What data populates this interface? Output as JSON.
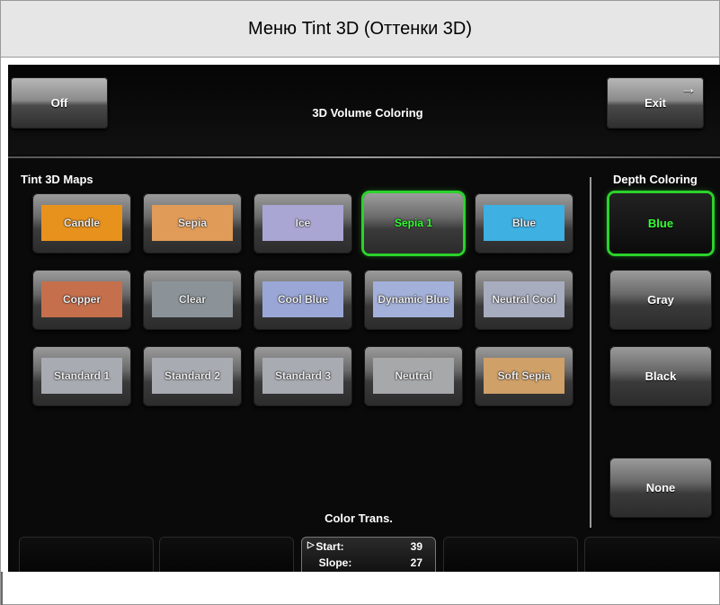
{
  "caption": "Меню Tint 3D (Оттенки 3D)",
  "header": {
    "off_label": "Off",
    "title": "3D Volume Coloring",
    "exit_label": "Exit"
  },
  "tint_maps": {
    "label": "Tint 3D Maps",
    "items": [
      {
        "label": "Candle",
        "color": "#e8921e"
      },
      {
        "label": "Sepia",
        "color": "#e09b58"
      },
      {
        "label": "Ice",
        "color": "#a9a6d3"
      },
      {
        "label": "Sepia 1",
        "color": "#e0a24a",
        "selected": true
      },
      {
        "label": "Blue",
        "color": "#3eb0e2"
      },
      {
        "label": "Copper",
        "color": "#c56f4c"
      },
      {
        "label": "Clear",
        "color": "#8b9398"
      },
      {
        "label": "Cool Blue",
        "color": "#9aa7d6"
      },
      {
        "label": "Dynamic Blue",
        "color": "#a3b0d9"
      },
      {
        "label": "Neutral Cool",
        "color": "#a7acbe"
      },
      {
        "label": "Standard 1",
        "color": "#a8abb1"
      },
      {
        "label": "Standard 2",
        "color": "#a8abb1"
      },
      {
        "label": "Standard 3",
        "color": "#a8abb1"
      },
      {
        "label": "Neutral",
        "color": "#a7a8aa"
      },
      {
        "label": "Soft Sepia",
        "color": "#cfa068"
      }
    ]
  },
  "depth_coloring": {
    "label": "Depth Coloring",
    "items": [
      {
        "label": "Blue",
        "selected": true
      },
      {
        "label": "Gray"
      },
      {
        "label": "Black"
      },
      {
        "label": "None"
      }
    ]
  },
  "color_trans": {
    "label": "Color Trans.",
    "start_label": "Start:",
    "start_value": "39",
    "slope_label": "Slope:",
    "slope_value": "27"
  },
  "colors": {
    "selected_glow": "#2bd22b",
    "selected_text": "#36ff36",
    "screen_bg": "#0a0a0a"
  }
}
